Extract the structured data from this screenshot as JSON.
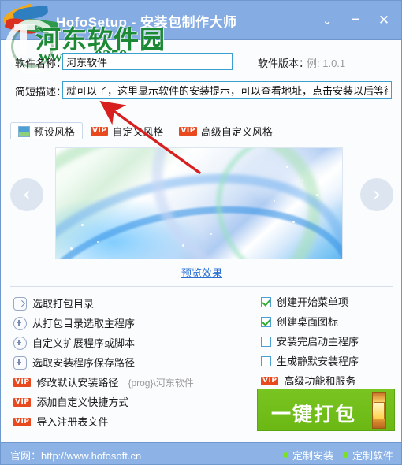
{
  "window": {
    "title": "HofoSetup - 安装包制作大师",
    "app_icon": "app-logo-icon",
    "controls": {
      "dropdown": "⌄",
      "minimize": "–",
      "close": "✕"
    }
  },
  "watermark": {
    "site_name": "河东软件园",
    "url": "www.pc0359.cn"
  },
  "form": {
    "name_label": "软件名称：",
    "name_value": "河东软件",
    "version_label": "软件版本：",
    "version_placeholder": "例: 1.0.1",
    "version_value": "",
    "desc_label": "简短描述：",
    "desc_value": "就可以了，这里显示软件的安装提示，可以查看地址，点击安装以后等待十"
  },
  "tabs": [
    {
      "label": "预设风格",
      "badge": "",
      "active": true
    },
    {
      "label": "自定义风格",
      "badge": "VIP",
      "active": false
    },
    {
      "label": "高级自定义风格",
      "badge": "VIP",
      "active": false
    }
  ],
  "preview": {
    "prev_arrow": "‹",
    "next_arrow": "›",
    "link_label": "预览效果"
  },
  "left_options": [
    {
      "icon": "folder-arrow-icon",
      "icon_type": "sq-arrow",
      "label": "选取打包目录",
      "hint": "",
      "badge": ""
    },
    {
      "icon": "circle-plus-icon",
      "icon_type": "circ-plus",
      "label": "从打包目录选取主程序",
      "hint": "",
      "badge": ""
    },
    {
      "icon": "circle-plus-icon",
      "icon_type": "circ-plus",
      "label": "自定义扩展程序或脚本",
      "hint": "",
      "badge": ""
    },
    {
      "icon": "square-plus-icon",
      "icon_type": "sq-plus",
      "label": "选取安装程序保存路径",
      "hint": "",
      "badge": ""
    },
    {
      "icon": "vip-badge-icon",
      "icon_type": "vip",
      "label": "修改默认安装路径",
      "hint": "{prog}\\河东软件",
      "badge": "VIP"
    },
    {
      "icon": "vip-badge-icon",
      "icon_type": "vip",
      "label": "添加自定义快捷方式",
      "hint": "",
      "badge": "VIP"
    },
    {
      "icon": "vip-badge-icon",
      "icon_type": "vip",
      "label": "导入注册表文件",
      "hint": "",
      "badge": "VIP"
    }
  ],
  "right_options": [
    {
      "type": "checkbox",
      "checked": true,
      "label": "创建开始菜单项",
      "badge": ""
    },
    {
      "type": "checkbox",
      "checked": true,
      "label": "创建桌面图标",
      "badge": ""
    },
    {
      "type": "checkbox",
      "checked": false,
      "label": "安装完启动主程序",
      "badge": ""
    },
    {
      "type": "checkbox",
      "checked": false,
      "label": "生成静默安装程序",
      "badge": ""
    },
    {
      "type": "vip",
      "checked": false,
      "label": "高级功能和服务",
      "badge": "VIP"
    }
  ],
  "action_button": {
    "label": "一键打包"
  },
  "statusbar": {
    "site_label": "官网：http://www.hofosoft.cn",
    "links": [
      {
        "label": "定制安装"
      },
      {
        "label": "定制软件"
      }
    ]
  },
  "colors": {
    "titlebar": "#85ade4",
    "statusbar": "#8cb2e6",
    "accent_blue": "#3ba0d0",
    "vip_badge": "#e8491e",
    "action_green": "#73bd1a",
    "link_blue": "#2a6fd4",
    "status_dot": "#79e21f",
    "annotation_red": "#d81f1f",
    "watermark_green": "#1c8a35"
  }
}
